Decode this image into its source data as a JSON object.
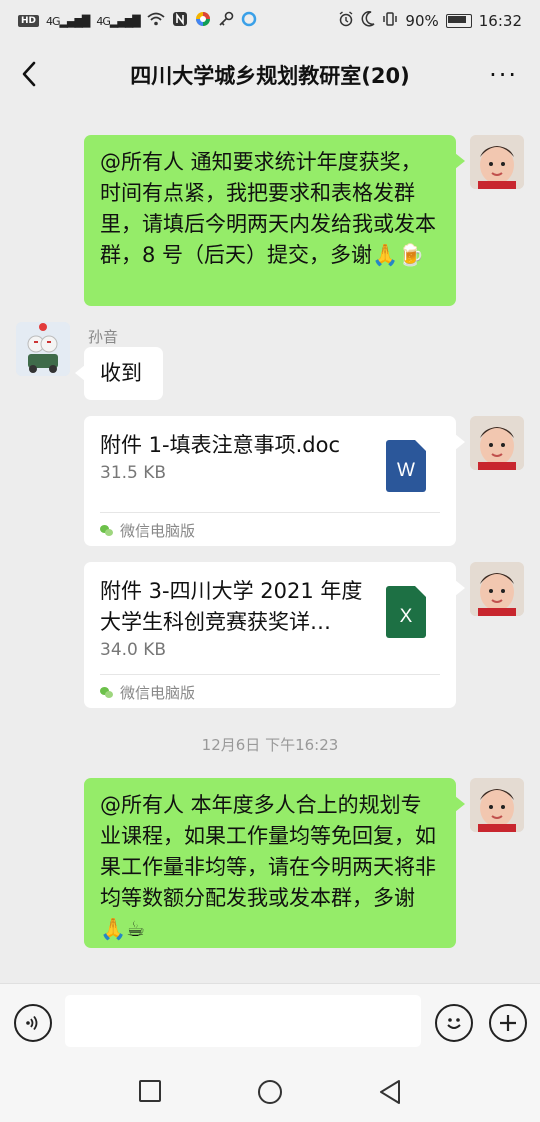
{
  "status_bar": {
    "hd": "HD",
    "signal1": "4G",
    "signal2": "4G",
    "battery_percent": "90%",
    "time": "16:32"
  },
  "nav": {
    "title": "四川大学城乡规划教研室(20)",
    "more": "···"
  },
  "messages": [
    {
      "type": "text",
      "side": "right",
      "text": "@所有人  通知要求统计年度获奖，时间有点紧，我把要求和表格发群里，请填后今明两天内发给我或发本群，8 号（后天）提交，多谢🙏🍺"
    },
    {
      "type": "text",
      "side": "left",
      "sender": "孙音",
      "text": "收到"
    },
    {
      "type": "file",
      "side": "right",
      "file_name": "附件 1-填表注意事项.doc",
      "file_size": "31.5 KB",
      "file_icon_letter": "W",
      "source": "微信电脑版"
    },
    {
      "type": "file",
      "side": "right",
      "file_name": "附件 3-四川大学 2021 年度大学生科创竞赛获奖详…",
      "file_size": "34.0 KB",
      "file_icon_letter": "X",
      "source": "微信电脑版"
    },
    {
      "type": "timestamp",
      "text": "12月6日 下午16:23"
    },
    {
      "type": "text",
      "side": "right",
      "text": "@所有人  本年度多人合上的规划专业课程，如果工作量均等免回复，如果工作量非均等，请在今明两天将非均等数额分配发我或发本群，多谢🙏☕"
    }
  ],
  "input_bar": {
    "placeholder": ""
  },
  "colors": {
    "bubble_green": "#95ec69",
    "word_blue": "#2b579a",
    "excel_green": "#1d7044",
    "background": "#ededed"
  },
  "icons": [
    "voice-icon",
    "emoji-icon",
    "plus-icon",
    "back-icon",
    "more-icon",
    "square-nav-icon",
    "circle-nav-icon",
    "triangle-nav-icon"
  ]
}
